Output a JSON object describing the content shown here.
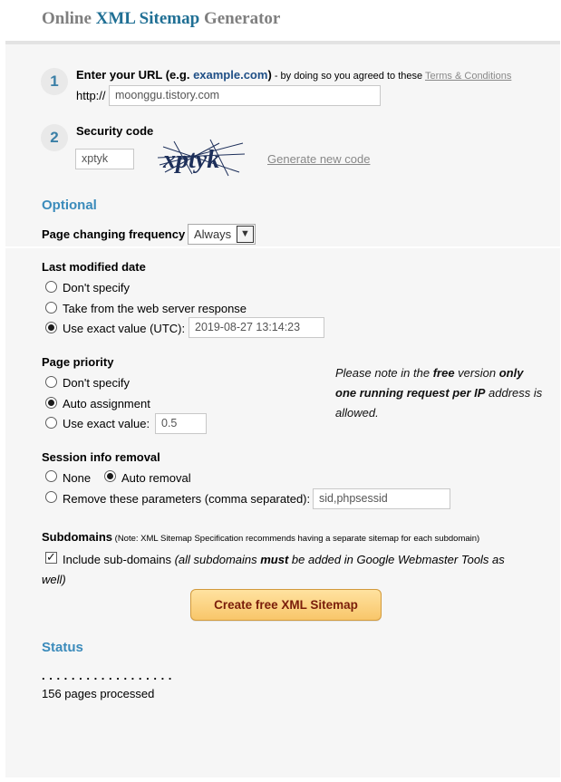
{
  "header": {
    "title_part1": "Online ",
    "title_accent": "XML Sitemap",
    "title_part2": " Generator"
  },
  "step1": {
    "number": "1",
    "label": "Enter your URL (e.g. ",
    "example": "example.com",
    "label_close": ")",
    "agree_text": " - by doing so you agreed to these ",
    "terms_link": "Terms & Conditions",
    "url_prefix": "http://",
    "url_value": "moonggu.tistory.com"
  },
  "step2": {
    "number": "2",
    "label": "Security code",
    "code_value": "xptyk",
    "captcha_text": "xptyk",
    "new_code_link": "Generate new code"
  },
  "optional": {
    "heading": "Optional",
    "frequency_label": "Page changing frequency",
    "frequency_value": "Always"
  },
  "last_modified": {
    "heading": "Last modified date",
    "options": [
      "Don't specify",
      "Take from the web server response",
      "Use exact value (UTC):"
    ],
    "selected_index": 2,
    "exact_value": "2019-08-27 13:14:23"
  },
  "priority": {
    "heading": "Page priority",
    "options": [
      "Don't specify",
      "Auto assignment",
      "Use exact value:"
    ],
    "selected_index": 1,
    "exact_value": "0.5",
    "note_pre": "Please note in the ",
    "note_free": "free",
    "note_mid": " version ",
    "note_bold": "only one running request per IP",
    "note_post": " address is allowed."
  },
  "session": {
    "heading": "Session info removal",
    "option_none": "None",
    "option_auto": "Auto removal",
    "option_remove": "Remove these parameters (comma separated):",
    "selected": "auto",
    "params_value": "sid,phpsessid"
  },
  "subdomains": {
    "heading": "Subdomains",
    "note": " (Note: XML Sitemap Specification recommends having a separate sitemap for each subdomain)",
    "include_label": "Include sub-domains ",
    "hint_pre": "(all subdomains ",
    "hint_bold": "must",
    "hint_post": " be added in Google Webmaster Tools as well)",
    "checked": true
  },
  "create_button": "Create free XML Sitemap",
  "status": {
    "heading": "Status",
    "dots": ". . . . . . . . . . . . . . . . . .",
    "processed": "156 pages processed"
  }
}
